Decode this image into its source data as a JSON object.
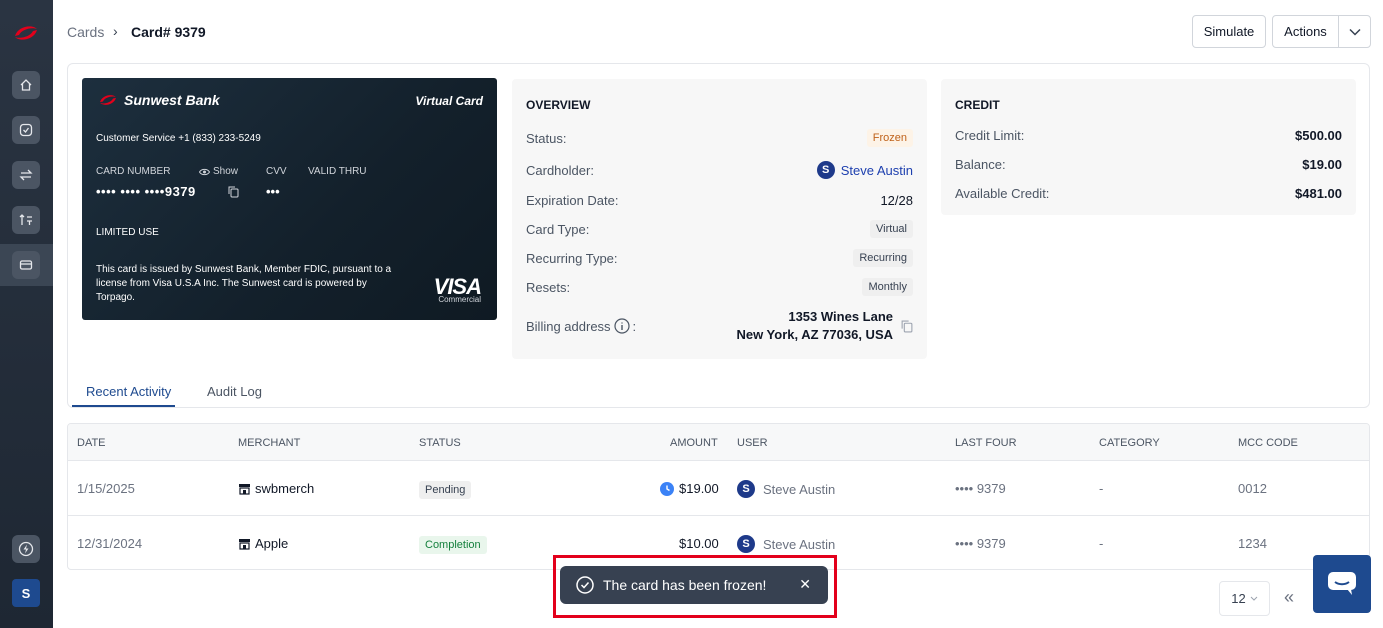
{
  "sidebar": {
    "nav": [
      {
        "name": "home",
        "icon": "home-icon"
      },
      {
        "name": "tasks",
        "icon": "check-icon"
      },
      {
        "name": "transfers",
        "icon": "transfer-icon"
      },
      {
        "name": "payments",
        "icon": "payment-icon"
      },
      {
        "name": "cards",
        "icon": "card-icon",
        "active": true
      }
    ],
    "bottom_icon": "lightning-icon",
    "avatar": "S"
  },
  "header": {
    "breadcrumb_root": "Cards",
    "breadcrumb_sep": "›",
    "breadcrumb_current": "Card# 9379",
    "simulate_label": "Simulate",
    "actions_label": "Actions"
  },
  "card": {
    "bank_name": "Sunwest Bank",
    "virtual_label": "Virtual Card",
    "customer_service": "Customer Service +1 (833) 233-5249",
    "card_number_label": "CARD NUMBER",
    "show_label": "Show",
    "cvv_label": "CVV",
    "valid_thru_label": "VALID THRU",
    "card_number": "•••• •••• ••••9379",
    "cvv": "•••",
    "limited_use": "LIMITED USE",
    "disclaimer": "This card is issued by Sunwest Bank, Member FDIC, pursuant to a license from Visa U.S.A Inc. The Sunwest card is powered by Torpago.",
    "network": "VISA",
    "network_sub": "Commercial"
  },
  "overview": {
    "title": "OVERVIEW",
    "status_label": "Status:",
    "status": "Frozen",
    "cardholder_label": "Cardholder:",
    "cardholder_initial": "S",
    "cardholder": "Steve Austin",
    "expiration_label": "Expiration Date:",
    "expiration": "12/28",
    "card_type_label": "Card Type:",
    "card_type": "Virtual",
    "recurring_label": "Recurring Type:",
    "recurring": "Recurring",
    "resets_label": "Resets:",
    "resets": "Monthly",
    "billing_label": "Billing address",
    "billing_colon": ":",
    "billing_line1": "1353 Wines Lane",
    "billing_line2": "New York, AZ 77036, USA"
  },
  "credit": {
    "title": "CREDIT",
    "limit_label": "Credit Limit:",
    "limit": "$500.00",
    "balance_label": "Balance:",
    "balance": "$19.00",
    "available_label": "Available Credit:",
    "available": "$481.00"
  },
  "tabs": {
    "recent": "Recent Activity",
    "audit": "Audit Log"
  },
  "table": {
    "headers": {
      "date": "DATE",
      "merchant": "MERCHANT",
      "status": "STATUS",
      "amount": "AMOUNT",
      "user": "USER",
      "last_four": "LAST FOUR",
      "category": "CATEGORY",
      "mcc": "MCC CODE"
    },
    "rows": [
      {
        "date": "1/15/2025",
        "merchant": "swbmerch",
        "status": "Pending",
        "amount": "$19.00",
        "user_initial": "S",
        "user": "Steve Austin",
        "last_four": "•••• 9379",
        "category": "-",
        "mcc": "0012"
      },
      {
        "date": "12/31/2024",
        "merchant": "Apple",
        "status": "Completion",
        "amount": "$10.00",
        "user_initial": "S",
        "user": "Steve Austin",
        "last_four": "•••• 9379",
        "category": "-",
        "mcc": "1234"
      }
    ]
  },
  "toast": {
    "message": "The card has been frozen!",
    "close": "✕"
  },
  "pagination": {
    "page_size": "12",
    "first_icon": "«"
  },
  "colors": {
    "accent": "#1e4a8f",
    "highlight": "#e3001b",
    "frozen": "#c0621a",
    "completion": "#15803d"
  }
}
